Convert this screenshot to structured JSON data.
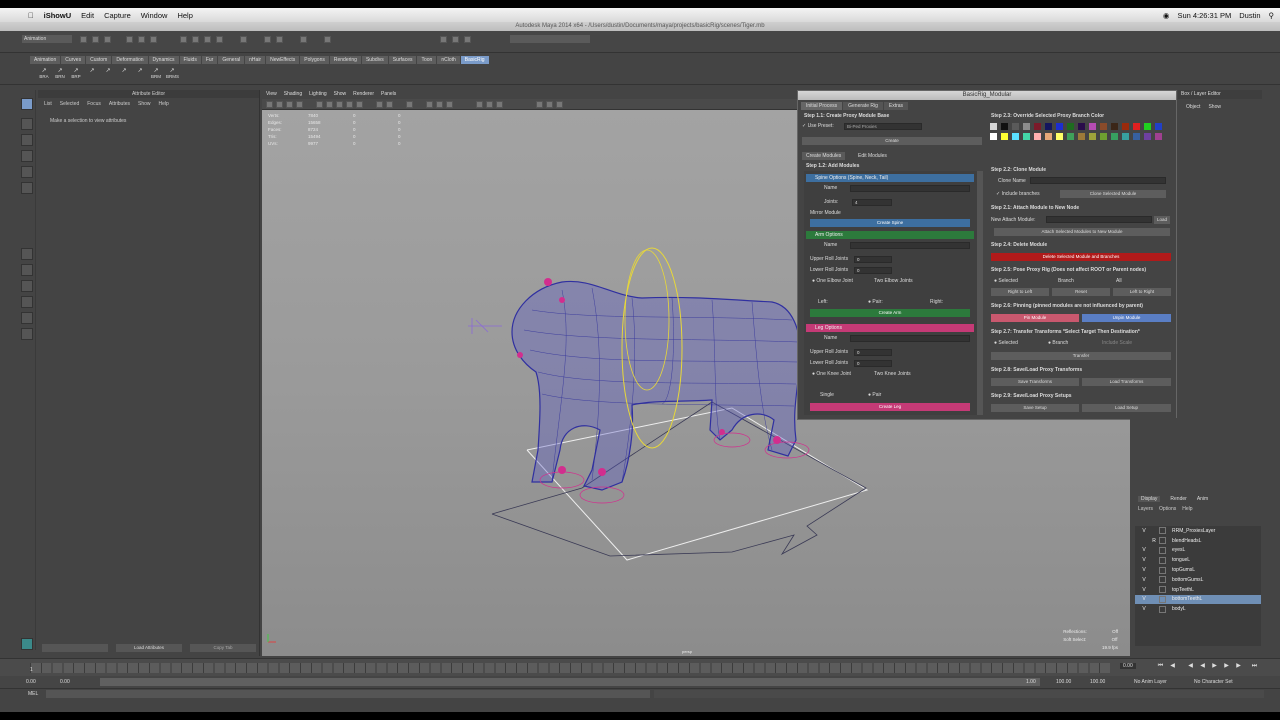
{
  "macbar": {
    "app": "iShowU",
    "menus": [
      "Edit",
      "Capture",
      "Window",
      "Help"
    ],
    "clock": "Sun 4:26:31 PM",
    "user": "Dustin"
  },
  "maya_title": "Autodesk Maya 2014 x64 - /Users/dustin/Documents/maya/projects/basicRig/scenes/Tiger.mb",
  "status": {
    "menuset": "Animation"
  },
  "shelf": {
    "tabs": [
      "Animation",
      "Curves",
      "Custom",
      "Deformation",
      "Dynamics",
      "Fluids",
      "Fur",
      "General",
      "nHair",
      "NewEffects",
      "Polygons",
      "Rendering",
      "Subdivs",
      "Surfaces",
      "Toon",
      "nCloth",
      "BasicRig"
    ],
    "active_tab": "BasicRig",
    "buttons": [
      "BRA",
      "BRN",
      "BRP",
      "",
      "",
      "",
      "",
      "BRM",
      "BRMS"
    ]
  },
  "attr_editor": {
    "title": "Attribute Editor",
    "menu": [
      "List",
      "Selected",
      "Focus",
      "Attributes",
      "Show",
      "Help"
    ],
    "message": "Make a selection to view attributes",
    "bottom": [
      "Load Attributes",
      "Copy Tab"
    ]
  },
  "viewport": {
    "menu": [
      "View",
      "Shading",
      "Lighting",
      "Show",
      "Renderer",
      "Panels"
    ],
    "hud": [
      {
        "label": "Verts:",
        "a": "7840",
        "b": "0",
        "c": "0"
      },
      {
        "label": "Edges:",
        "a": "15658",
        "b": "0",
        "c": "0"
      },
      {
        "label": "Faces:",
        "a": "8724",
        "b": "0",
        "c": "0"
      },
      {
        "label": "Tris:",
        "a": "15494",
        "b": "0",
        "c": "0"
      },
      {
        "label": "UVs:",
        "a": "9977",
        "b": "0",
        "c": "0"
      }
    ],
    "hud_right": [
      {
        "label": "Reflections:",
        "value": "Off"
      },
      {
        "label": "Soft Select:",
        "value": "Off"
      }
    ],
    "fps": "19.9 fps",
    "camera": "persp"
  },
  "rig": {
    "title": "BasicRig_Modular",
    "tabs": [
      "Initial Process",
      "Generate Rig",
      "Extras"
    ],
    "step11": "Step 1.1: Create Proxy Module Base",
    "use_preset": "Use Preset:",
    "preset_value": "Bi-Ped Proxies",
    "create": "Create",
    "subtabs": [
      "Create Modules",
      "Edit Modules"
    ],
    "step12": "Step 1.2: Add Modules",
    "spine": {
      "header": "Spine Options (Spine, Neck, Tail)",
      "name": "Name",
      "joints": "Joints:",
      "joints_val": "4",
      "mirror": "Mirror Module",
      "btn": "Create Spine"
    },
    "arm": {
      "header": "Arm Options",
      "name": "Name",
      "upper": "Upper Roll Joints",
      "upper_val": "0",
      "lower": "Lower Roll Joints",
      "lower_val": "0",
      "one": "One Elbow Joint",
      "two": "Two Elbow Joints",
      "left": "Left:",
      "pair": "Pair:",
      "right": "Right:",
      "btn": "Create Arm"
    },
    "leg": {
      "header": "Leg Options",
      "name": "Name",
      "upper": "Upper Roll Joints",
      "upper_val": "0",
      "lower": "Lower Roll Joints",
      "lower_val": "0",
      "one": "One Knee Joint",
      "two": "Two Knee Joints",
      "single": "Single",
      "pair": "Pair",
      "btn": "Create Leg"
    },
    "step23": "Step 2.3: Override Selected Proxy Branch Color",
    "step22": "Step 2.2: Clone Module",
    "clone_name": "Clone Name",
    "include_branches": "Include branches",
    "clone_btn": "Clone Selected Module",
    "step21": "Step 2.1: Attach Module to New Node",
    "new_attach": "New Attach Module:",
    "load": "Load",
    "attach_btn": "Attach Selected Modules to New Module",
    "step24": "Step 2.4: Delete Module",
    "delete_btn": "Delete Selected Module and Branches",
    "step25": "Step 2.5: Pose Proxy Rig (Does not affect ROOT or Parent nodes)",
    "selected": "Selected",
    "branch": "Branch",
    "all": "All",
    "r2l": "Right to Left",
    "reset": "Reset",
    "l2r": "Left to Right",
    "step26": "Step 2.6: Pinning (pinned modules are not influenced by parent)",
    "pin": "Pin Module",
    "unpin": "Unpin Module",
    "step27": "Step 2.7: Transfer Transforms  *Select Target Then Destination*",
    "selected2": "Selected",
    "branch2": "Branch",
    "include_scale": "Include Scale",
    "transfer": "Transfer",
    "step28": "Step 2.8: Save/Load Proxy Transforms",
    "save_t": "Save Transforms",
    "load_t": "Load Transforms",
    "step29": "Step 2.9: Save/Load Proxy Setups",
    "save_s": "Save Setup",
    "load_s": "Load Setup",
    "swatches": [
      "#d8d8d8",
      "#111111",
      "#5a5a5a",
      "#8c8c8c",
      "#7b1a2a",
      "#14165e",
      "#1c2ed0",
      "#1e6b1f",
      "#2a0c4a",
      "#b44cb3",
      "#8a4b2a",
      "#3b2618",
      "#9a2a0c",
      "#e02020",
      "#1fd01f",
      "#2140c8",
      "#ffffff",
      "#ffff33",
      "#5ae0ff",
      "#44d8a8",
      "#ffb0b0",
      "#e6a878",
      "#ffff66",
      "#3fa05a",
      "#9c7a38",
      "#9ea33a",
      "#6ea030",
      "#37a060",
      "#37a0a0",
      "#3760a0",
      "#6e40a0",
      "#a04090"
    ]
  },
  "channelbox": {
    "title": "Box / Layer Editor",
    "tabs": [
      "Object",
      "Show"
    ]
  },
  "layers": {
    "tabs": [
      "Display",
      "Render",
      "Anim"
    ],
    "menu": [
      "Layers",
      "Options",
      "Help"
    ],
    "rows": [
      {
        "v": "V",
        "r": "",
        "name": "RRM_ProxiesLayer"
      },
      {
        "v": "",
        "r": "R",
        "name": "blendHeadsL"
      },
      {
        "v": "V",
        "r": "",
        "name": "eyesL"
      },
      {
        "v": "V",
        "r": "",
        "name": "tongueL"
      },
      {
        "v": "V",
        "r": "",
        "name": "topGumsL"
      },
      {
        "v": "V",
        "r": "",
        "name": "bottomGumsL"
      },
      {
        "v": "V",
        "r": "",
        "name": "topTeethL"
      },
      {
        "v": "V",
        "r": "",
        "name": "bottomTeethL",
        "selected": true
      },
      {
        "v": "V",
        "r": "",
        "name": "bodyL"
      }
    ]
  },
  "timeline": {
    "start": "1",
    "current": "0.00",
    "range_start": "0.00",
    "range_inner": "0.00",
    "range_a": "1.00",
    "range_end": "100.00",
    "range_end2": "100.00",
    "anim_layer": "No Anim Layer",
    "char_set": "No Character Set",
    "cmd": "MEL"
  }
}
